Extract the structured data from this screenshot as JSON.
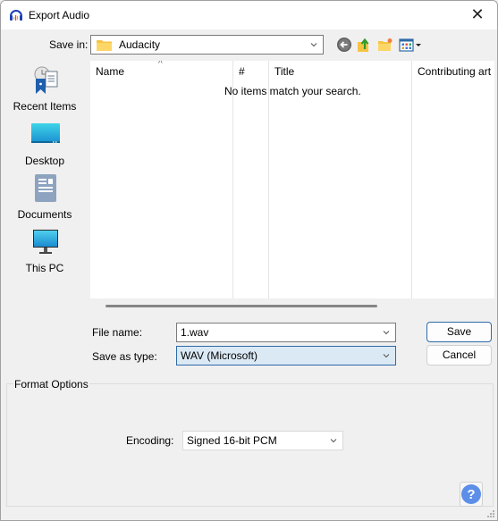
{
  "window": {
    "title": "Export Audio",
    "close_glyph": "✕"
  },
  "toolbar": {
    "save_in_label": "Save in:",
    "save_in_value": "Audacity",
    "icons": [
      "back-icon",
      "up-folder-icon",
      "new-folder-icon",
      "view-menu-icon"
    ]
  },
  "places": [
    {
      "label": "Recent Items",
      "icon": "recent-items-icon"
    },
    {
      "label": "Desktop",
      "icon": "desktop-icon"
    },
    {
      "label": "Documents",
      "icon": "documents-icon"
    },
    {
      "label": "This PC",
      "icon": "this-pc-icon"
    }
  ],
  "file_list": {
    "columns": [
      "Name",
      "#",
      "Title",
      "Contributing art"
    ],
    "sort_indicator": "^",
    "empty_message": "No items match your search."
  },
  "form": {
    "file_name_label": "File name:",
    "file_name_value": "1.wav",
    "save_as_type_label": "Save as type:",
    "save_as_type_value": "WAV (Microsoft)",
    "save_button": "Save",
    "cancel_button": "Cancel"
  },
  "format_options": {
    "title": "Format Options",
    "encoding_label": "Encoding:",
    "encoding_value": "Signed 16-bit PCM",
    "help_glyph": "?"
  },
  "colors": {
    "accent": "#2f6aa6",
    "selected_bg": "#dbe9f5",
    "help_blue": "#5d8fe8"
  }
}
